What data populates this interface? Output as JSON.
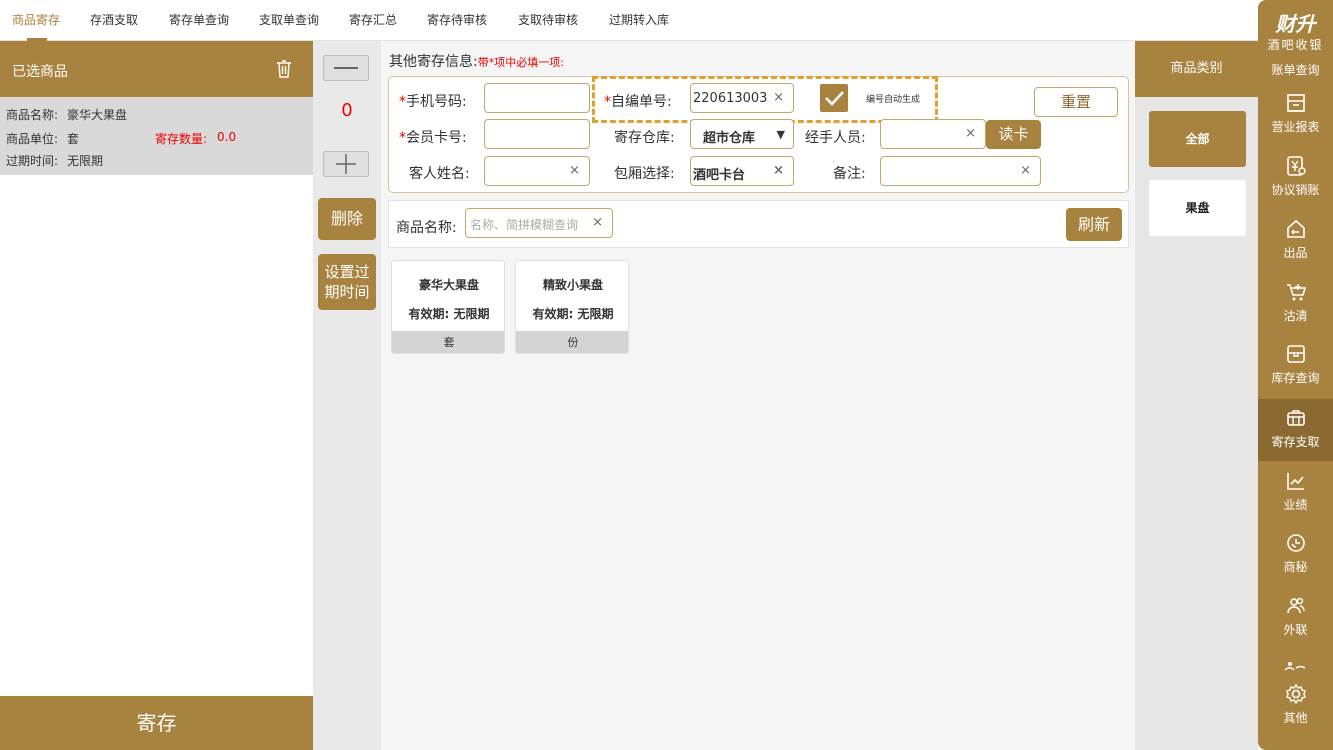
{
  "topnav": {
    "tabs": [
      "商品寄存",
      "存酒支取",
      "寄存单查询",
      "支取单查询",
      "寄存汇总",
      "寄存待审核",
      "支取待审核",
      "过期转入库"
    ]
  },
  "left": {
    "title": "已选商品",
    "item": {
      "name_label": "商品名称:",
      "name": "豪华大果盘",
      "unit_label": "商品单位:",
      "unit": "套",
      "qty_label": "寄存数量:",
      "qty": "0.0",
      "expire_label": "过期时间:",
      "expire": "无限期"
    },
    "submit": "寄存"
  },
  "mid": {
    "qty": "0",
    "delete": "删除",
    "set_expire": "设置过期时间"
  },
  "form": {
    "title": "其他寄存信息:",
    "hint": "带*项中必填一项:",
    "phone_label": "手机号码:",
    "member_label": "会员卡号:",
    "guest_label": "客人姓名:",
    "code_label": "自编单号:",
    "code_value": "220613003",
    "auto_label": "编号自动生成",
    "warehouse_label": "寄存仓库:",
    "warehouse_value": "超市仓库",
    "room_label": "包厢选择:",
    "room_value": "酒吧卡台",
    "handler_label": "经手人员:",
    "remark_label": "备注:",
    "reset": "重置",
    "read_card": "读卡",
    "clear_glyph": "×",
    "req_mark": "*"
  },
  "search": {
    "label": "商品名称:",
    "placeholder": "名称、简拼模糊查询",
    "refresh": "刷新"
  },
  "products": [
    {
      "name": "豪华大果盘",
      "expire": "有效期: 无限期",
      "unit": "套"
    },
    {
      "name": "精致小果盘",
      "expire": "有效期: 无限期",
      "unit": "份"
    }
  ],
  "category": {
    "title": "商品类别",
    "items": [
      "全部",
      "果盘"
    ]
  },
  "rnav": {
    "brand": "财升",
    "brand_sub": "酒吧收银",
    "items": [
      "账单查询",
      "营业报表",
      "协议销账",
      "出品",
      "沽清",
      "库存查询",
      "寄存支取",
      "业绩",
      "商秘",
      "外联",
      "其他"
    ]
  },
  "colors": {
    "accent": "#a8823f",
    "active_nav": "#8a6a30",
    "required": "#e00000",
    "highlight_box": "#e0a030"
  }
}
